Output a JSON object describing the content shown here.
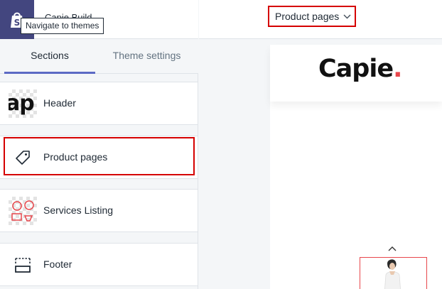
{
  "sidebar": {
    "shop_name": "Capie Build",
    "tooltip": "Navigate to themes",
    "tabs": [
      {
        "label": "Sections"
      },
      {
        "label": "Theme settings"
      }
    ],
    "sections": [
      {
        "label": "Header",
        "thumb_text": "ap"
      },
      {
        "label": "Product pages"
      },
      {
        "label": "Services Listing"
      },
      {
        "label": "Footer"
      }
    ]
  },
  "topbar": {
    "page_selector": "Product pages"
  },
  "preview": {
    "brand": "Capie",
    "brand_dot": "."
  },
  "colors": {
    "accent": "#5c6ac4",
    "highlight": "#d50000",
    "brand_dot": "#e8474c",
    "shop_logo_bg": "#43467f"
  },
  "icons": [
    "shopify-bag-icon",
    "price-tag-icon",
    "services-thumbnail-icon",
    "footer-layout-icon",
    "chevron-down-icon",
    "chevron-up-icon"
  ]
}
